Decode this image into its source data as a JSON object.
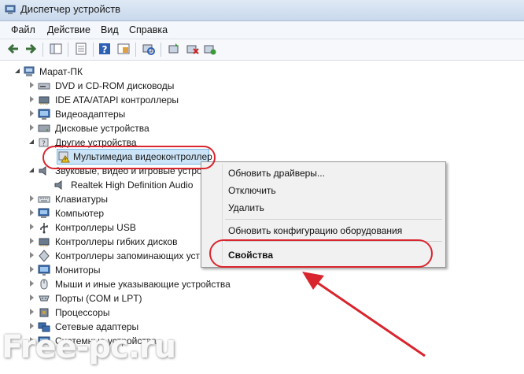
{
  "window": {
    "title": "Диспетчер устройств"
  },
  "menu": [
    "Файл",
    "Действие",
    "Вид",
    "Справка"
  ],
  "tree": {
    "root": "Марат-ПК",
    "categories": [
      "DVD и CD-ROM дисководы",
      "IDE ATA/ATAPI контроллеры",
      "Видеоадаптеры",
      "Дисковые устройства",
      "Другие устройства",
      "Мультимедиа видеоконтроллер",
      "Звуковые, видео и игровые устро",
      "Realtek High Definition Audio",
      "Клавиатуры",
      "Компьютер",
      "Контроллеры USB",
      "Контроллеры гибких дисков",
      "Контроллеры запоминающих уст",
      "Мониторы",
      "Мыши и иные указывающие устройства",
      "Порты (COM и LPT)",
      "Процессоры",
      "Сетевые адаптеры",
      "Системные устройства"
    ]
  },
  "context_menu": {
    "update_drivers": "Обновить драйверы...",
    "disable": "Отключить",
    "delete": "Удалить",
    "scan_hardware": "Обновить конфигурацию оборудования",
    "properties": "Свойства"
  },
  "watermark": "Free-pc.ru",
  "colors": {
    "annotation": "#d9252d",
    "selection": "#cce4f7"
  }
}
